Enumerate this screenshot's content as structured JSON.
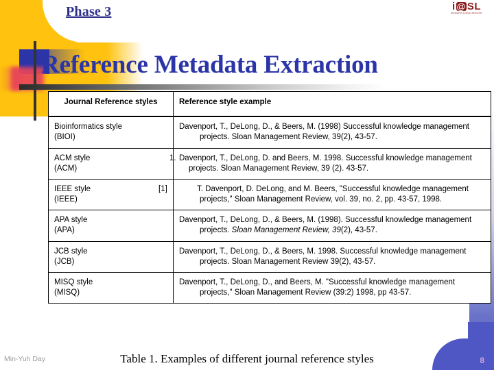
{
  "slide": {
    "phase_label": "Phase 3",
    "title": "Reference Metadata Extraction",
    "logo": {
      "mark_left": "i",
      "mark_at": "@",
      "mark_right": "SL",
      "sub_line": "INFORMATION SCIENCE LABORATORY",
      "color": "#8B1A1A"
    }
  },
  "table": {
    "headers": {
      "style_column": "Journal Reference styles",
      "example_column": "Reference style example"
    },
    "rows": [
      {
        "style": "Bioinformatics style\n(BIOI)",
        "example_prefix": "",
        "example": "Davenport, T., DeLong, D., & Beers, M. (1998) Successful knowledge management projects. Sloan Management Review, 39(2), 43-57.",
        "italic_part": ""
      },
      {
        "style": "ACM style\n(ACM)",
        "example_prefix": "1.",
        "example": "Davenport, T., DeLong, D. and Beers, M. 1998. Successful knowledge management projects. Sloan Management Review, 39 (2). 43-57.",
        "italic_part": ""
      },
      {
        "style": "IEEE style\n(IEEE)",
        "example_prefix": "[1]",
        "example": "T. Davenport, D. DeLong, and M. Beers, \"Successful knowledge management projects,\" Sloan Management Review, vol. 39, no. 2, pp. 43-57, 1998.",
        "italic_part": ""
      },
      {
        "style": "APA style\n(APA)",
        "example_prefix": "",
        "example_before": "Davenport, T., DeLong, D., & Beers, M. (1998). Successful knowledge management projects. ",
        "italic_part": "Sloan Management Review, 39",
        "example_after": "(2), 43-57."
      },
      {
        "style": "JCB style\n(JCB)",
        "example_prefix": "",
        "example": "Davenport, T., DeLong, D., & Beers, M. 1998. Successful knowledge management projects. Sloan Management Review 39(2), 43-57.",
        "italic_part": ""
      },
      {
        "style": "MISQ style\n(MISQ)",
        "example_prefix": "",
        "example": "Davenport, T., DeLong, D., and Beers, M. \"Successful knowledge management projects,\" Sloan Management Review (39:2) 1998, pp 43-57.",
        "italic_part": ""
      }
    ]
  },
  "footer": {
    "author": "Min-Yuh Day",
    "caption": "Table 1. Examples of different journal reference styles",
    "page_number": "8"
  },
  "colors": {
    "accent_yellow": "#FFC20E",
    "title_blue": "#2B35A8",
    "phase_blue": "#2B2E8C",
    "band_blue": "#4F57C4",
    "logo_red": "#8B1A1A"
  }
}
